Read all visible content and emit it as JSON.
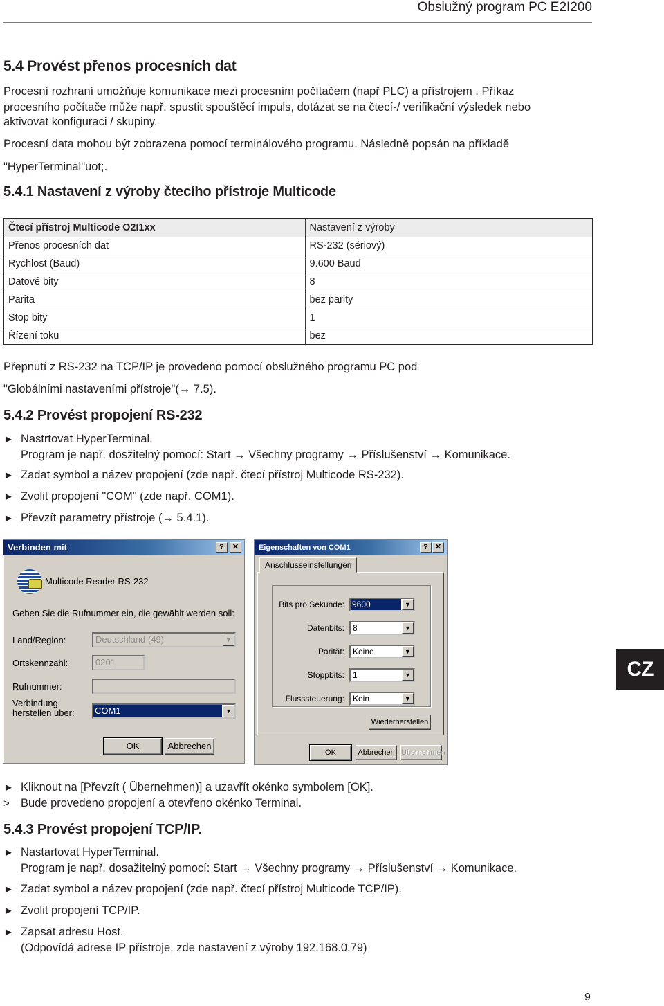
{
  "header": {
    "title": "Obslužný program PC E2I200"
  },
  "section": {
    "title": "5.4 Provést přenos procesních dat",
    "intro_lines": [
      "Procesní rozhraní umožňuje komunikace mezi procesním počítačem  (např PLC) a přístrojem . Příkaz",
      "procesního počítače může např. spustit spouštěcí impuls, dotázat se na  čtecí-/ verifikační výsledek nebo",
      "aktivovat konfiguraci / skupiny."
    ],
    "para2_line1": "Procesní data mohou být zobrazena pomocí terminálového programu. Následně popsán na příkladě",
    "para2_line2": "\"HyperTerminal\"uot;."
  },
  "sub1": {
    "title": "5.4.1 Nastavení z výroby čtecího přístroje Multicode",
    "table": {
      "header": [
        "Čtecí přístroj Multicode O2I1xx",
        "Nastavení z výroby"
      ],
      "rows": [
        [
          "Přenos procesních dat",
          "RS-232 (sériový)"
        ],
        [
          "Rychlost (Baud)",
          "9.600 Baud"
        ],
        [
          "Datové bity",
          "8"
        ],
        [
          "Parita",
          "bez parity"
        ],
        [
          "Stop bity",
          "1"
        ],
        [
          "Řízení toku",
          "bez"
        ]
      ]
    },
    "note_line1": "Přepnutí z RS-232 na TCP/IP je provedeno pomocí obslužného programu PC pod",
    "note_line2": "\"Globálními nastaveními přístroje\"(→ 7.5)."
  },
  "sub2": {
    "title": "5.4.2 Provést propojení RS-232",
    "steps": [
      {
        "marker": "►",
        "text": "Nastrtovat HyperTerminal.",
        "sub": "Program je např. dosžitelný pomocí: Start → Všechny programy → Příslušenství → Komunikace."
      },
      {
        "marker": "►",
        "text": "Zadat symbol a název propojení (zde např. čtecí přístroj Multicode RS-232).",
        "sub": ""
      },
      {
        "marker": "►",
        "text": "Zvolit propojení \"COM\" (zde např. COM1).",
        "sub": ""
      },
      {
        "marker": "►",
        "text": "Převzít parametry přístroje (→ 5.4.1).",
        "sub": ""
      }
    ],
    "after_steps": [
      {
        "marker": "►",
        "text": "Kliknout na [Převzít ( Übernehmen)] a uzavřít okénko symbolem [OK]."
      },
      {
        "marker": ">",
        "text": "Bude provedeno propojení a otevřeno okénko Terminal."
      }
    ]
  },
  "dialog_connect": {
    "title": "Verbinden mit",
    "help": "?",
    "close": "✕",
    "connection_name": "Multicode Reader RS-232",
    "prompt": "Geben Sie die Rufnummer ein, die gewählt werden soll:",
    "country_label": "Land/Region:",
    "country_value": "Deutschland (49)",
    "area_label": "Ortskennzahl:",
    "area_value": "0201",
    "phone_label": "Rufnummer:",
    "phone_value": "",
    "connect_label_1": "Verbindung",
    "connect_label_2": "herstellen über:",
    "connect_value": "COM1",
    "ok": "OK",
    "cancel": "Abbrechen"
  },
  "dialog_com": {
    "title": "Eigenschaften von COM1",
    "help": "?",
    "close": "✕",
    "tab": "Anschlusseinstellungen",
    "bits_label": "Bits pro Sekunde:",
    "bits_value": "9600",
    "databits_label": "Datenbits:",
    "databits_value": "8",
    "parity_label": "Parität:",
    "parity_value": "Keine",
    "stopbits_label": "Stoppbits:",
    "stopbits_value": "1",
    "flow_label": "Flusssteuerung:",
    "flow_value": "Kein",
    "restore": "Wiederherstellen",
    "ok": "OK",
    "cancel": "Abbrechen",
    "apply": "Übernehmen"
  },
  "sub3": {
    "title": "5.4.3 Provést propojení TCP/IP.",
    "steps": [
      {
        "marker": "►",
        "text": "Nastartovat HyperTerminal.",
        "sub": "Program je např. dosažitelný pomocí: Start → Všechny programy → Příslušenství → Komunikace."
      },
      {
        "marker": "►",
        "text": "Zadat symbol a název propojení (zde např. čtecí přístroj Multicode TCP/IP).",
        "sub": ""
      },
      {
        "marker": "►",
        "text": "Zvolit propojení TCP/IP.",
        "sub": ""
      },
      {
        "marker": "►",
        "text": "Zapsat adresu Host.",
        "sub": "(Odpovídá adrese IP přístroje, zde nastavení z výroby 192.168.0.79)"
      }
    ]
  },
  "badge": {
    "language": "CZ"
  },
  "footer": {
    "page_number": "9"
  }
}
